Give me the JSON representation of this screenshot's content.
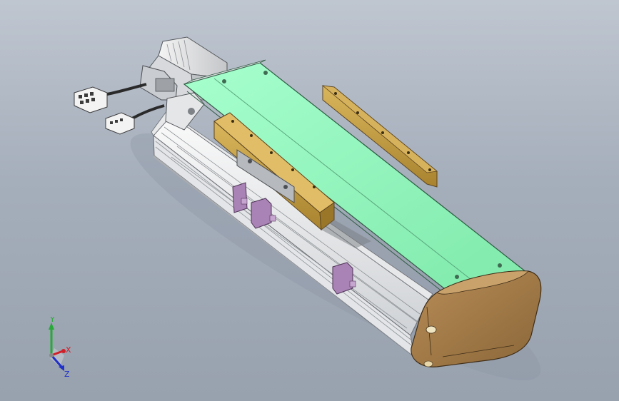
{
  "viewport": {
    "background_top": "#bfc6d0",
    "background_bottom": "#98a1ae"
  },
  "model": {
    "description_colors": {
      "cover": "#8ef5b8",
      "carriage_plate": "#c9a54a",
      "end_cap": "#a27c4c",
      "body": "#f2f3f4",
      "clamps": "#a983b5",
      "cables": "#2a2a2a",
      "connectors": "#f0f0f0"
    }
  },
  "triad": {
    "x_label": "X",
    "y_label": "Y",
    "z_label": "Z",
    "x_color": "#d0202a",
    "y_color": "#2aa83a",
    "z_color": "#2030c8"
  }
}
